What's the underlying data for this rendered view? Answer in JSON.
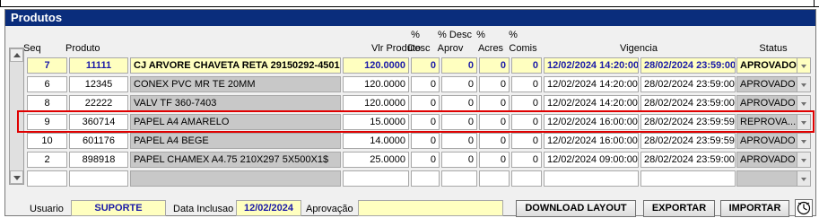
{
  "panel": {
    "title": "Produtos"
  },
  "headers": {
    "seq": "Seq",
    "produto": "Produto",
    "vlr_produto": "Vlr Produto",
    "desc_top": "%",
    "desc": "Desc",
    "desc_aprov_top": "% Desc",
    "desc_aprov": "Aprov",
    "acres_top": "%",
    "acres": "Acres",
    "comis_top": "%",
    "comis": "Comis",
    "vigencia": "Vigencia",
    "status": "Status"
  },
  "rows": [
    {
      "seq": "7",
      "code": "11111",
      "name": "CJ ARVORE CHAVETA RETA 29150292-4501",
      "vlr": "120.0000",
      "desc": "0",
      "desc_aprov": "0",
      "acres": "0",
      "comis": "0",
      "vig_ini": "12/02/2024 14:20:00",
      "vig_fim": "28/02/2024 23:59:00",
      "status": "APROVADO"
    },
    {
      "seq": "6",
      "code": "12345",
      "name": "CONEX PVC MR TE 20MM",
      "vlr": "120.0000",
      "desc": "0",
      "desc_aprov": "0",
      "acres": "0",
      "comis": "0",
      "vig_ini": "12/02/2024 14:20:00",
      "vig_fim": "28/02/2024 23:59:00",
      "status": "APROVADO"
    },
    {
      "seq": "8",
      "code": "22222",
      "name": "VALV TF 360-7403",
      "vlr": "120.0000",
      "desc": "0",
      "desc_aprov": "0",
      "acres": "0",
      "comis": "0",
      "vig_ini": "12/02/2024 14:20:00",
      "vig_fim": "28/02/2024 23:59:00",
      "status": "APROVADO"
    },
    {
      "seq": "9",
      "code": "360714",
      "name": "PAPEL A4 AMARELO",
      "vlr": "15.0000",
      "desc": "0",
      "desc_aprov": "0",
      "acres": "0",
      "comis": "0",
      "vig_ini": "12/02/2024 16:00:00",
      "vig_fim": "28/02/2024 23:59:59",
      "status": "REPROVA..."
    },
    {
      "seq": "10",
      "code": "601176",
      "name": "PAPEL A4 BEGE",
      "vlr": "14.0000",
      "desc": "0",
      "desc_aprov": "0",
      "acres": "0",
      "comis": "0",
      "vig_ini": "12/02/2024 16:00:00",
      "vig_fim": "28/02/2024 23:59:59",
      "status": "APROVADO"
    },
    {
      "seq": "2",
      "code": "898918",
      "name": "PAPEL CHAMEX A4.75 210X297 5X500X1$",
      "vlr": "25.0000",
      "desc": "0",
      "desc_aprov": "0",
      "acres": "0",
      "comis": "0",
      "vig_ini": "12/02/2024 09:00:00",
      "vig_fim": "28/02/2024 23:59:00",
      "status": "APROVADO"
    },
    {
      "seq": "",
      "code": "",
      "name": "",
      "vlr": "",
      "desc": "",
      "desc_aprov": "",
      "acres": "",
      "comis": "",
      "vig_ini": "",
      "vig_fim": "",
      "status": ""
    }
  ],
  "footer": {
    "usuario_label": "Usuario",
    "usuario_value": "SUPORTE",
    "data_inclusao_label": "Data Inclusao",
    "data_inclusao_value": "12/02/2024",
    "aprovacao_label": "Aprovação",
    "aprovacao_value": ""
  },
  "buttons": {
    "download_layout": "DOWNLOAD LAYOUT",
    "exportar": "EXPORTAR",
    "importar": "IMPORTAR"
  },
  "colors": {
    "title_bar": "#0a2d7c",
    "highlight_border": "#e00000",
    "field_yellow": "#ffffc0",
    "readonly_gray": "#c8c8c8"
  }
}
